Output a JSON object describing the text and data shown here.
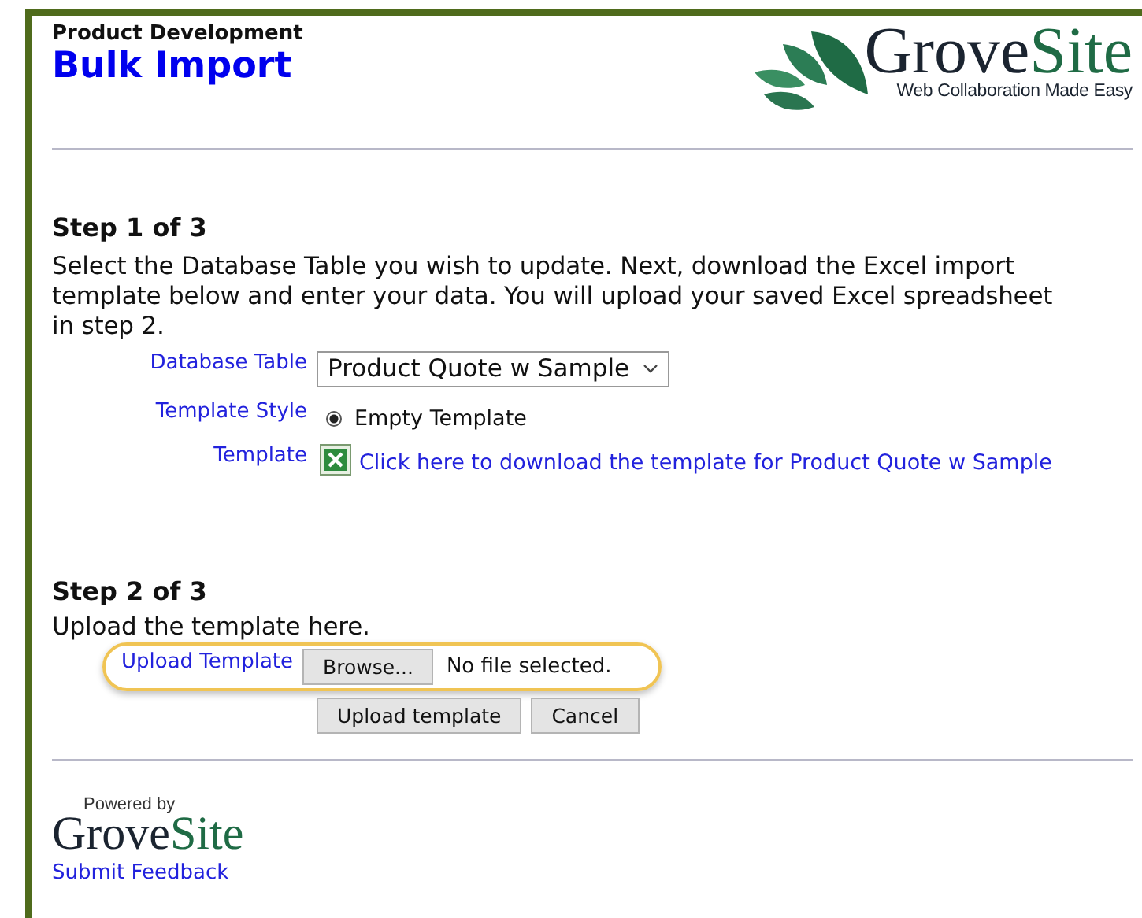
{
  "header": {
    "section": "Product Development",
    "title": "Bulk Import"
  },
  "logo": {
    "brand_dark": "Grove",
    "brand_light": "Site",
    "tagline": "Web Collaboration Made Easy"
  },
  "step1": {
    "heading": "Step 1 of 3",
    "text": "Select the Database Table you wish to update. Next, download the Excel import template below and enter your data. You will upload your saved Excel spreadsheet in step 2.",
    "fields": [
      {
        "kind": "select",
        "label": "Database Table",
        "value": "Product Quote w Sample"
      },
      {
        "kind": "radio",
        "label": "Template Style",
        "option": "Empty Template",
        "selected": true
      },
      {
        "kind": "link",
        "label": "Template",
        "link": "Click here to download the template for Product Quote w Sample"
      }
    ]
  },
  "step2": {
    "heading": "Step 2 of 3",
    "text": "Upload the template here.",
    "upload_label": "Upload Template",
    "browse": "Browse...",
    "file_status": "No file selected.",
    "buttons": [
      "Upload template",
      "Cancel"
    ]
  },
  "footer": {
    "powered_by": "Powered by",
    "brand_dark": "Grove",
    "brand_light": "Site",
    "feedback": "Submit Feedback"
  }
}
